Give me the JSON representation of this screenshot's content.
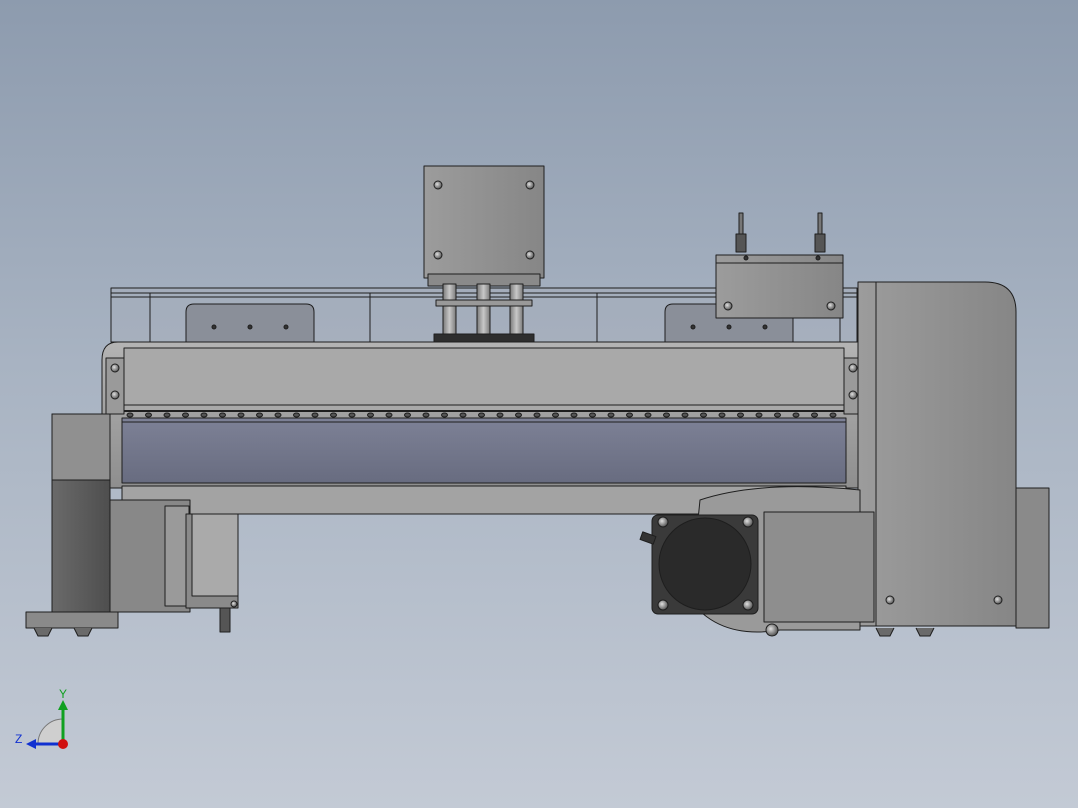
{
  "viewport": {
    "background_top": "#8d9bae",
    "background_bottom": "#c3cad5"
  },
  "model": {
    "edge_color": "#1e1e1e",
    "body_color": "#9a9a9a",
    "dark_part_color": "#3a3a3a",
    "belt_color": "#6e7385"
  },
  "triad": {
    "y_label": "Y",
    "z_label": "Z",
    "y_axis_color": "#10a020",
    "z_axis_color": "#1030d0",
    "x_axis_color": "#d01010"
  }
}
